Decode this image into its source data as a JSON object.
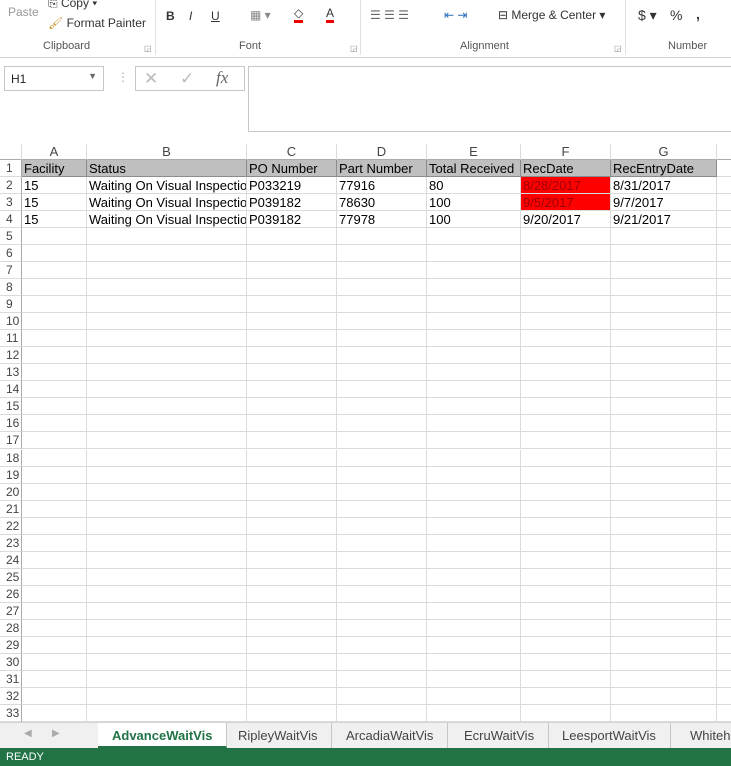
{
  "ribbon": {
    "clipboard": {
      "paste": "Paste",
      "copy": "Copy",
      "format_painter": "Format Painter",
      "label": "Clipboard"
    },
    "font": {
      "bold": "B",
      "italic": "I",
      "underline": "U",
      "label": "Font"
    },
    "alignment": {
      "merge_center": "Merge & Center",
      "label": "Alignment"
    },
    "number": {
      "currency": "$",
      "percent": "%",
      "comma": ",",
      "label": "Number"
    }
  },
  "formula_bar": {
    "name_box": "H1",
    "fx": "fx",
    "cancel": "✕",
    "enter": "✓",
    "value": ""
  },
  "columns": [
    "A",
    "B",
    "C",
    "D",
    "E",
    "F",
    "G"
  ],
  "rows": [
    [
      "Facility",
      "Status",
      "PO Number",
      "Part Number",
      "Total Received",
      "RecDate",
      "RecEntryDate"
    ],
    [
      "15",
      "Waiting On Visual Inspection",
      "P033219",
      "77916",
      "80",
      "8/28/2017",
      "8/31/2017"
    ],
    [
      "15",
      "Waiting On Visual Inspection",
      "P039182",
      "78630",
      "100",
      "9/5/2017",
      "9/7/2017"
    ],
    [
      "15",
      "Waiting On Visual Inspection",
      "P039182",
      "77978",
      "100",
      "9/20/2017",
      "9/21/2017"
    ]
  ],
  "row_count": 33,
  "highlight_color": "#ff0000",
  "header_fill": "#bfbfbf",
  "highlighted_cells": [
    "F2",
    "F3"
  ],
  "sheets": [
    "AdvanceWaitVis",
    "RipleyWaitVis",
    "ArcadiaWaitVis",
    "EcruWaitVis",
    "LeesportWaitVis",
    "Whiteh"
  ],
  "active_sheet": "AdvanceWaitVis",
  "status": "READY"
}
